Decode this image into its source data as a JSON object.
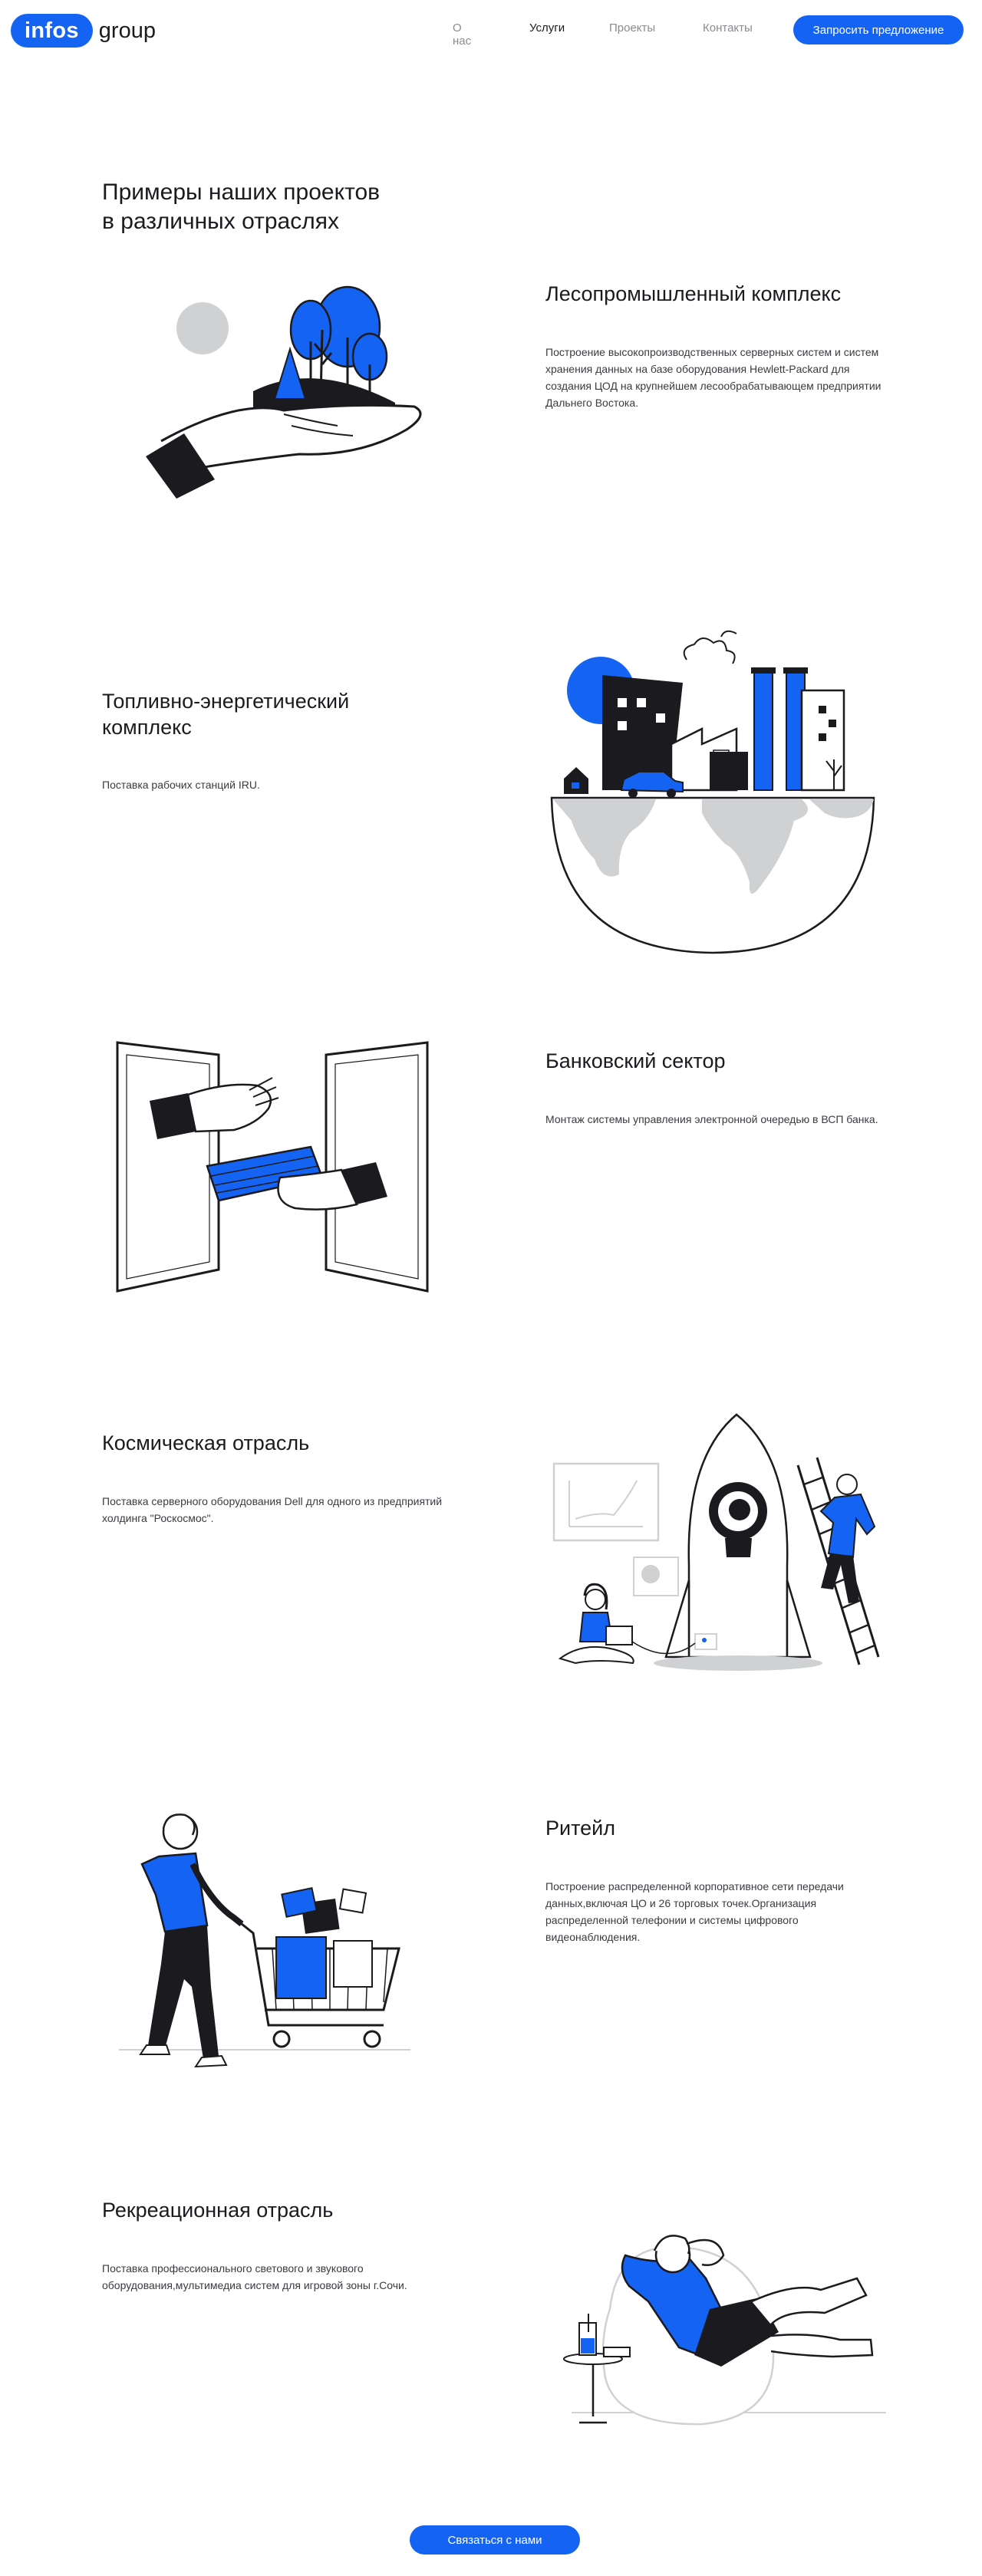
{
  "brand": {
    "pill": "infos",
    "word": "group"
  },
  "nav": {
    "about": "О нас",
    "services": "Услуги",
    "projects": "Проекты",
    "contacts": "Контакты"
  },
  "header_cta": "Запросить предложение",
  "page_title": "Примеры наших проектов\nв различных отраслях",
  "sections": [
    {
      "title": "Лесопромышленный комплекс",
      "desc": "Построение высокопроизводственных серверных систем и систем хранения данных на базе оборудования Hewlett-Packard для создания ЦОД на крупнейшем лесообрабатывающем предприятии Дальнего Востока."
    },
    {
      "title": "Топливно-энергетический\nкомплекс",
      "desc": "Поставка рабочих станций IRU."
    },
    {
      "title": "Банковский сектор",
      "desc": "Монтаж системы управления электронной очередью в ВСП банка."
    },
    {
      "title": "Космическая отрасль",
      "desc": "Поставка серверного оборудования Dell для одного из предприятий холдинга \"Роскосмос\"."
    },
    {
      "title": "Ритейл",
      "desc": "Построение распределенной корпоративное сети передачи данных,включая ЦО и 26 торговых точек.Организация распределенной телефонии и системы цифрового видеонаблюдения."
    },
    {
      "title": "Рекреационная отрасль",
      "desc": "Поставка профессионального светового и звукового оборудования,мультимедиа систем для игровой зоны г.Сочи."
    }
  ],
  "contact_button": "Связаться с нами",
  "colors": {
    "accent": "#1463f3",
    "text": "#1b1b1f",
    "grey": "#cfd1d3"
  },
  "icons": [
    "hand-forest-illustration",
    "industry-globe-illustration",
    "money-transfer-illustration",
    "rocket-illustration",
    "shopping-cart-illustration",
    "relax-illustration"
  ]
}
